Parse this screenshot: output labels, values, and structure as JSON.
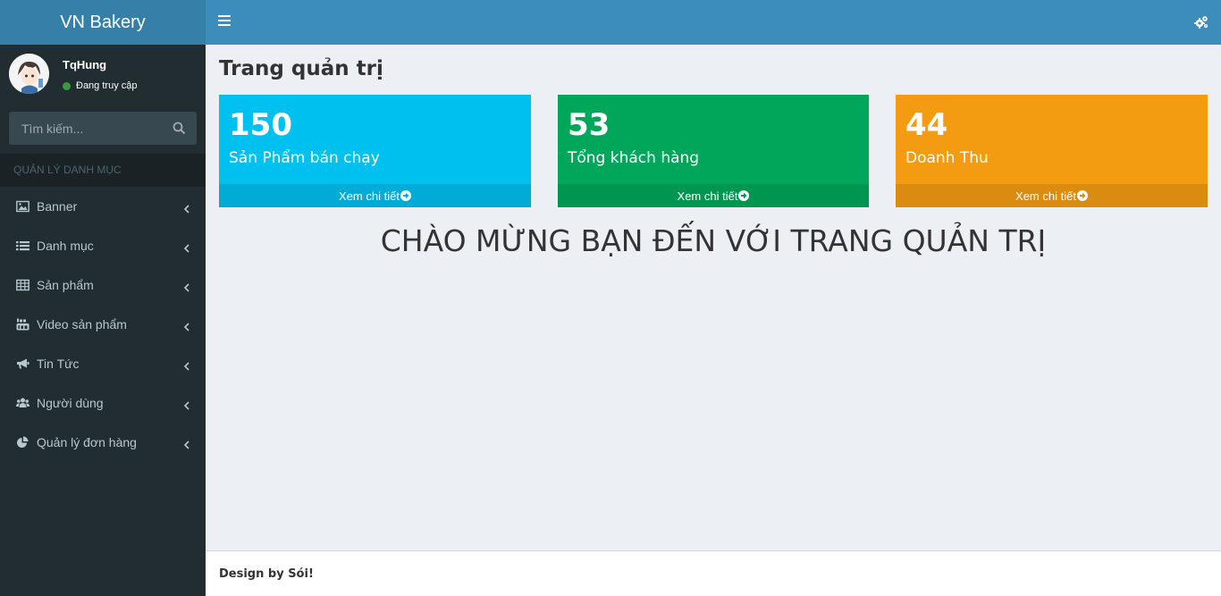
{
  "header": {
    "brand": "VN Bakery",
    "toggle_icon": "hamburger-icon",
    "settings_icon": "gears-icon"
  },
  "sidebar": {
    "user": {
      "name": "TqHung",
      "status": "Đang truy cập",
      "status_color": "#3c9a3c"
    },
    "search": {
      "placeholder": "Tìm kiếm..."
    },
    "section_header": "QUẢN LÝ DANH MỤC",
    "items": [
      {
        "label": "Banner",
        "icon": "image-icon"
      },
      {
        "label": "Danh mục",
        "icon": "list-icon"
      },
      {
        "label": "Sản phẩm",
        "icon": "table-icon"
      },
      {
        "label": "Video sản phẩm",
        "icon": "youtube-icon"
      },
      {
        "label": "Tin Tức",
        "icon": "bullhorn-icon"
      },
      {
        "label": "Người dùng",
        "icon": "users-icon"
      },
      {
        "label": "Quản lý đơn hàng",
        "icon": "pie-chart-icon"
      }
    ]
  },
  "main": {
    "title": "Trang quản trị",
    "stats": [
      {
        "value": "150",
        "label": "Sản Phẩm bán chạy",
        "more": "Xem chi tiết",
        "color": "#00c0ef"
      },
      {
        "value": "53",
        "label": "Tổng khách hàng",
        "more": "Xem chi tiết",
        "color": "#00a65a"
      },
      {
        "value": "44",
        "label": "Doanh Thu",
        "more": "Xem chi tiết",
        "color": "#f39c12"
      }
    ],
    "welcome": "CHÀO MỪNG BẠN ĐẾN VỚI TRANG QUẢN TRỊ"
  },
  "footer": {
    "text": "Design by Sói!"
  },
  "colors": {
    "header": "#3c8dbc",
    "logo_bg": "#367fa9",
    "sidebar_bg": "#222d32",
    "content_bg": "#ecf0f5"
  }
}
